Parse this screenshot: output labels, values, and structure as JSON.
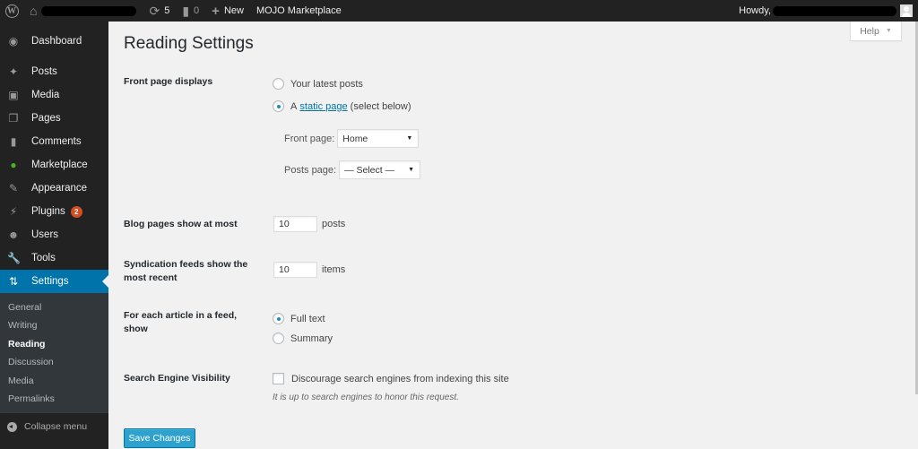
{
  "admin_bar": {
    "updates_count": "5",
    "comments_count": "0",
    "new_label": "New",
    "marketplace_label": "MOJO Marketplace",
    "howdy_label": "Howdy,"
  },
  "sidebar": {
    "items": [
      {
        "label": "Dashboard",
        "icon": "dashboard-icon"
      },
      {
        "label": "Posts",
        "icon": "pin-icon"
      },
      {
        "label": "Media",
        "icon": "media-icon"
      },
      {
        "label": "Pages",
        "icon": "pages-icon"
      },
      {
        "label": "Comments",
        "icon": "comment-icon"
      },
      {
        "label": "Marketplace",
        "icon": "mojo-monster-icon"
      },
      {
        "label": "Appearance",
        "icon": "paintbrush-icon"
      },
      {
        "label": "Plugins",
        "icon": "plugin-icon",
        "badge": "2"
      },
      {
        "label": "Users",
        "icon": "user-icon"
      },
      {
        "label": "Tools",
        "icon": "wrench-icon"
      },
      {
        "label": "Settings",
        "icon": "settings-icon",
        "active": true
      }
    ],
    "submenu": [
      "General",
      "Writing",
      "Reading",
      "Discussion",
      "Media",
      "Permalinks"
    ],
    "current_submenu": "Reading",
    "collapse_label": "Collapse menu"
  },
  "help_tab": {
    "label": "Help"
  },
  "page": {
    "title": "Reading Settings",
    "front_page_displays": {
      "label": "Front page displays",
      "option_latest": "Your latest posts",
      "option_static_prefix": "A",
      "option_static_link": "static page",
      "option_static_suffix": "(select below)",
      "selected": "static page",
      "front_page_label": "Front page:",
      "front_page_value": "Home",
      "posts_page_label": "Posts page:",
      "posts_page_value": "— Select —"
    },
    "blog_pages": {
      "label": "Blog pages show at most",
      "value": "10",
      "unit": "posts"
    },
    "syndication": {
      "label": "Syndication feeds show the most recent",
      "value": "10",
      "unit": "items"
    },
    "feed_article": {
      "label": "For each article in a feed, show",
      "option_full": "Full text",
      "option_summary": "Summary",
      "selected": "Full text"
    },
    "search_visibility": {
      "label": "Search Engine Visibility",
      "checkbox_label": "Discourage search engines from indexing this site",
      "checked": false,
      "description": "It is up to search engines to honor this request."
    },
    "save_label": "Save Changes"
  },
  "colors": {
    "admin_bar_bg": "#222222",
    "active_menu": "#0073aa",
    "badge": "#d54e21",
    "primary_button": "#2ea2cc",
    "page_bg": "#f1f1f1"
  }
}
